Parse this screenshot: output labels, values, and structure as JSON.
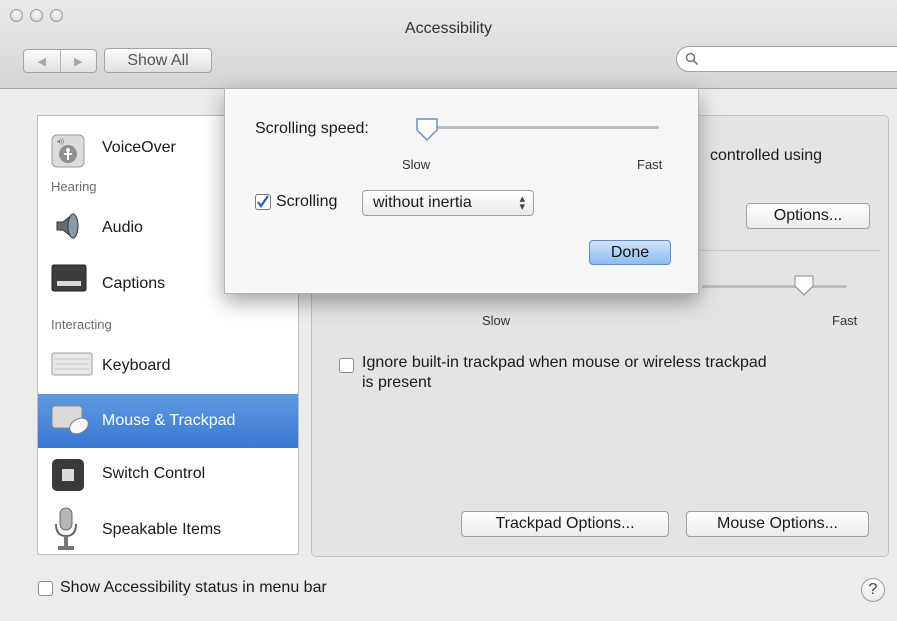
{
  "window": {
    "title": "Accessibility"
  },
  "toolbar": {
    "back_label": "◀",
    "forward_label": "▶",
    "show_all_label": "Show All",
    "search_placeholder": ""
  },
  "sidebar": {
    "items": [
      {
        "label": "VoiceOver",
        "icon": "voiceover-icon"
      },
      {
        "section": "Hearing"
      },
      {
        "label": "Audio",
        "icon": "speaker-icon"
      },
      {
        "label": "Captions",
        "icon": "captions-icon"
      },
      {
        "section": "Interacting"
      },
      {
        "label": "Keyboard",
        "icon": "keyboard-icon"
      },
      {
        "label": "Mouse & Trackpad",
        "icon": "mouse-trackpad-icon",
        "selected": true
      },
      {
        "label": "Switch Control",
        "icon": "switch-control-icon"
      },
      {
        "label": "Speakable Items",
        "icon": "microphone-icon"
      }
    ]
  },
  "panel": {
    "description_visible": "controlled using",
    "options_label": "Options...",
    "double_click": {
      "slow": "Slow",
      "fast": "Fast",
      "value": 0.7
    },
    "ignore_trackpad_label": "Ignore built-in trackpad when mouse or wireless trackpad",
    "ignore_trackpad_label_2": "is present",
    "ignore_trackpad_checked": false,
    "trackpad_options_label": "Trackpad Options...",
    "mouse_options_label": "Mouse Options..."
  },
  "sheet": {
    "scrolling_speed_label": "Scrolling speed:",
    "slow": "Slow",
    "fast": "Fast",
    "scrolling_speed_value": 0.0,
    "scrolling_label": "Scrolling",
    "scrolling_checked": true,
    "scrolling_mode": "without inertia",
    "done_label": "Done"
  },
  "footer": {
    "status_label": "Show Accessibility status in menu bar",
    "status_checked": false,
    "help_label": "?"
  },
  "colors": {
    "selection": "#3a78d3",
    "default_button": "#8dbbf2"
  }
}
